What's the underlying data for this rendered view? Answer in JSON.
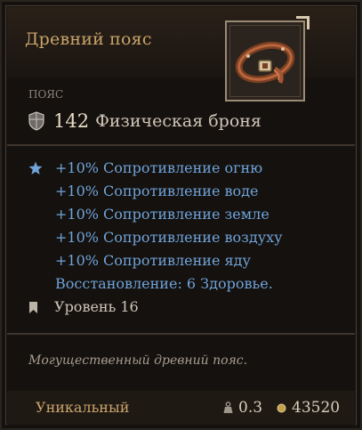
{
  "item": {
    "name": "Древний пояс",
    "category": "ПОЯС",
    "armor": {
      "value": "142",
      "label": "Физическая броня"
    },
    "stats": [
      "+10%  Сопротивление огню",
      "+10%  Сопротивление воде",
      "+10%  Сопротивление земле",
      "+10%  Сопротивление воздуху",
      "+10%  Сопротивление яду",
      "Восстановление: 6 Здоровье."
    ],
    "level": "Уровень 16",
    "description": "Могущественный древний пояс.",
    "rarity": "Уникальный",
    "weight": "0.3",
    "price": "43520"
  },
  "icons": {
    "portrait": "belt-icon",
    "armor": "shield-icon",
    "stats": "star-icon",
    "level": "level-bookmark-icon",
    "weight": "weight-icon",
    "price": "coin-icon"
  },
  "colors": {
    "title": "#c9a46a",
    "stat_text": "#6fa3d9",
    "rarity": "#c9a46a",
    "background": "#15110e"
  }
}
